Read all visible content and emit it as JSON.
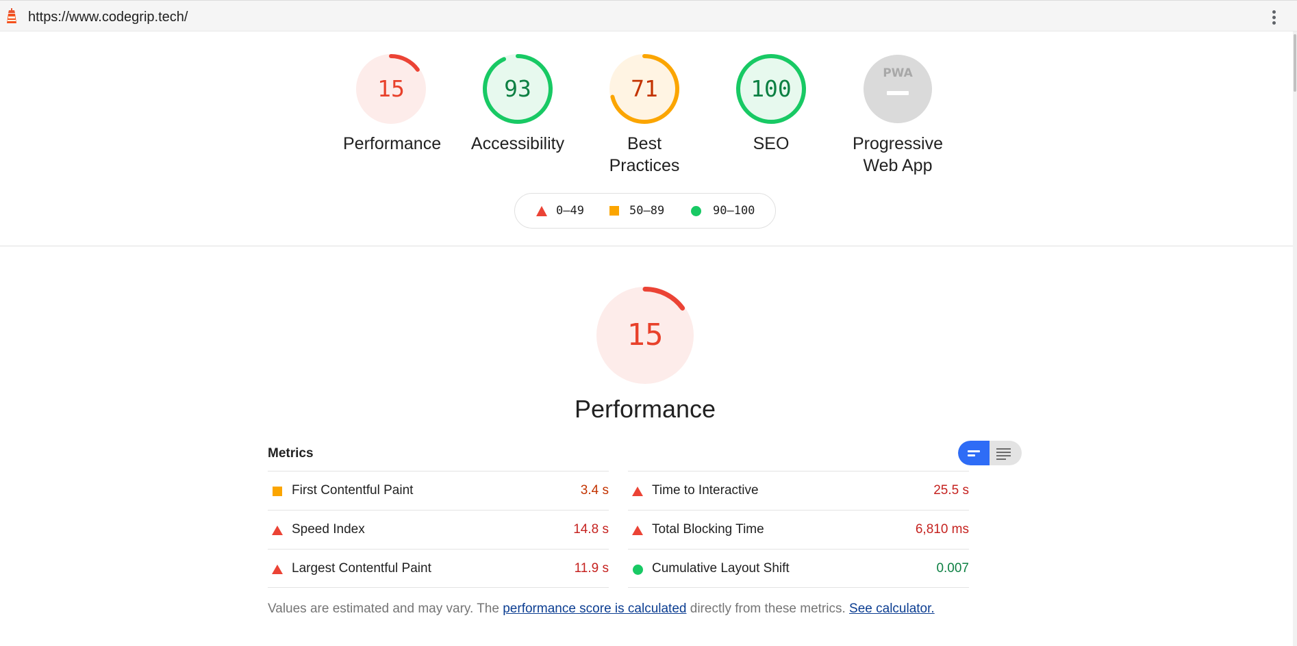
{
  "url_bar": {
    "url": "https://www.codegrip.tech/",
    "icon": "lighthouse-icon",
    "menu_icon": "kebab-menu-icon"
  },
  "gauges": [
    {
      "score": "15",
      "label": "Performance",
      "fraction": 0.15,
      "color": "#eb4335",
      "bg": "#fdecea"
    },
    {
      "score": "93",
      "label": "Accessibility",
      "fraction": 0.93,
      "color": "#18c964",
      "bg": "#e7f9ee"
    },
    {
      "score": "71",
      "label": "Best Practices",
      "fraction": 0.71,
      "color": "#fba500",
      "bg": "#fff4e3"
    },
    {
      "score": "100",
      "label": "SEO",
      "fraction": 1.0,
      "color": "#18c964",
      "bg": "#e7f9ee"
    },
    {
      "label_line1": "Progressive",
      "label_line2": "Web App",
      "badge_text": "PWA"
    }
  ],
  "legend": [
    {
      "icon": "fail-triangle-icon",
      "range": "0–49"
    },
    {
      "icon": "average-square-icon",
      "range": "50–89"
    },
    {
      "icon": "pass-circle-icon",
      "range": "90–100"
    }
  ],
  "performance": {
    "score": "15",
    "fraction": 0.15,
    "title": "Performance",
    "metrics_heading": "Metrics",
    "metrics_left": [
      {
        "name": "First Contentful Paint",
        "value": "3.4 s",
        "rating": "average"
      },
      {
        "name": "Speed Index",
        "value": "14.8 s",
        "rating": "fail"
      },
      {
        "name": "Largest Contentful Paint",
        "value": "11.9 s",
        "rating": "fail"
      }
    ],
    "metrics_right": [
      {
        "name": "Time to Interactive",
        "value": "25.5 s",
        "rating": "fail"
      },
      {
        "name": "Total Blocking Time",
        "value": "6,810 ms",
        "rating": "fail"
      },
      {
        "name": "Cumulative Layout Shift",
        "value": "0.007",
        "rating": "pass"
      }
    ],
    "footnote_prefix": "Values are estimated and may vary. The",
    "footnote_link1": "performance score is calculated",
    "footnote_middle": "directly from these metrics.",
    "footnote_link2": "See calculator."
  },
  "colors": {
    "fail": "#eb4335",
    "average": "#fba500",
    "pass": "#18c964",
    "link": "#0b3d91",
    "toggle_active": "#2e6cf6"
  }
}
